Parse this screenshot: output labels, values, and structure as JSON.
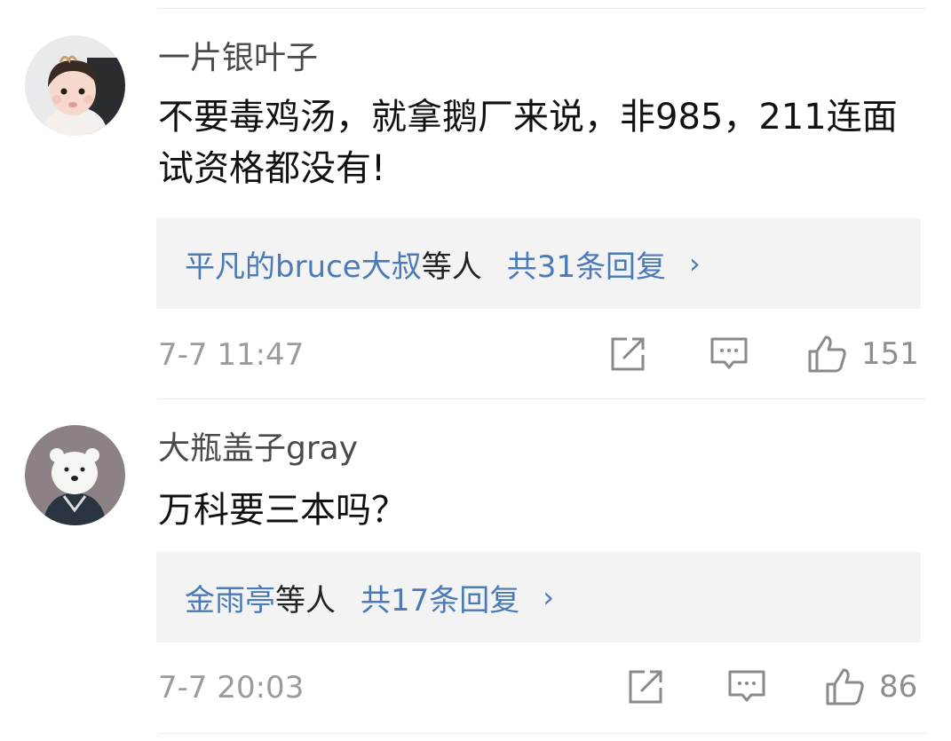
{
  "colors": {
    "link": "#4a7bb7",
    "secondary": "#9b9b9b",
    "panel": "#f3f3f3"
  },
  "comments": [
    {
      "user": "一片银叶子",
      "avatar_icon": "toddler-avatar",
      "text": "不要毒鸡汤，就拿鹅厂来说，非985，211连面试资格都没有!",
      "replies": {
        "names_prefix": "平凡的bruce大叔",
        "names_suffix": "等人",
        "total": "共31条回复",
        "chevron": "›"
      },
      "time": "7-7 11:47",
      "likes": "151"
    },
    {
      "user": "大瓶盖子gray",
      "avatar_icon": "bear-avatar",
      "text": "万科要三本吗？",
      "replies": {
        "names_prefix": "金雨亭",
        "names_suffix": "等人",
        "total": "共17条回复",
        "chevron": "›"
      },
      "time": "7-7 20:03",
      "likes": "86"
    }
  ]
}
